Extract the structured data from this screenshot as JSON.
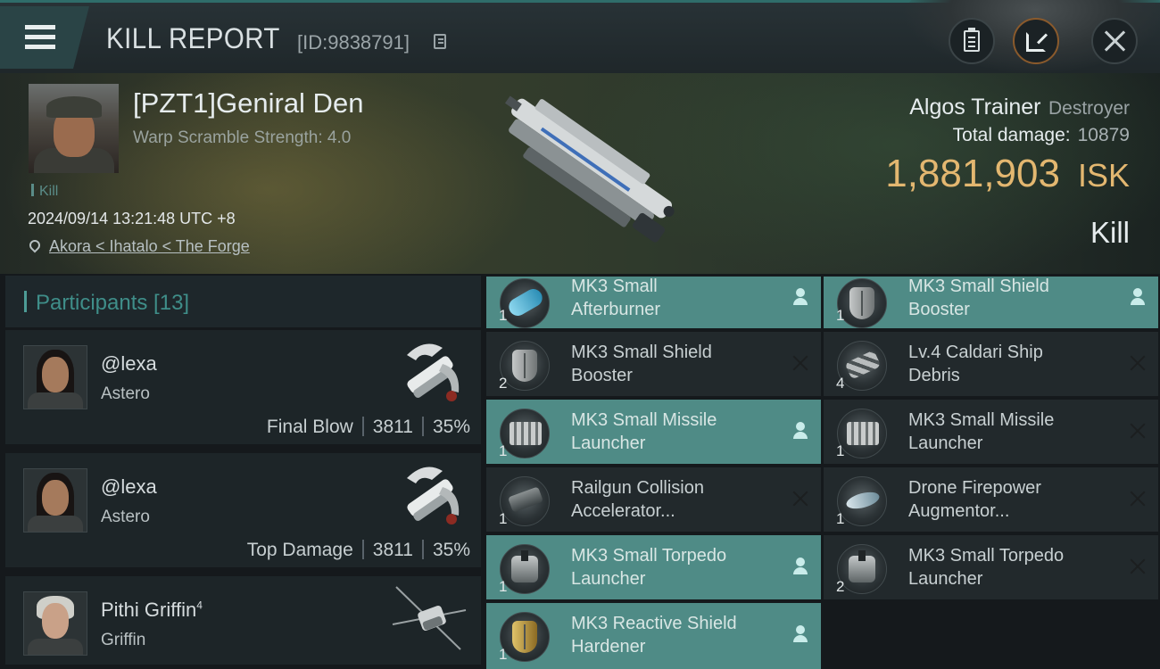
{
  "header": {
    "title": "KILL REPORT",
    "report_id": "[ID:9838791]"
  },
  "victim": {
    "pilot_name": "[PZT1]Geniral Den",
    "warp_scramble": "Warp Scramble Strength: 4.0",
    "kill_tag": "Kill",
    "timestamp": "2024/09/14 13:21:48 UTC +8",
    "location": "Akora < Ihatalo < The Forge",
    "ship_name": "Algos Trainer",
    "ship_class": "Destroyer",
    "total_damage_label": "Total damage:",
    "total_damage_value": "10879",
    "isk_value": "1,881,903",
    "isk_unit": "ISK",
    "kill_type": "Kill"
  },
  "participants": {
    "title": "Participants [13]",
    "items": [
      {
        "name": "@lexa",
        "rank_sup": "",
        "ship": "Astero",
        "role": "Final Blow",
        "damage": "3811",
        "percent": "35%"
      },
      {
        "name": "@lexa",
        "rank_sup": "",
        "ship": "Astero",
        "role": "Top Damage",
        "damage": "3811",
        "percent": "35%"
      },
      {
        "name": "Pithi Griffin",
        "rank_sup": "4",
        "ship": "Griffin",
        "role": "",
        "damage": "",
        "percent": ""
      }
    ]
  },
  "modules": [
    {
      "label": "MK3 Small\nAfterburner",
      "qty": "1",
      "state": "fitted",
      "icon": "afterburner-icon"
    },
    {
      "label": "MK3 Small Shield\nBooster",
      "qty": "1",
      "state": "fitted",
      "icon": "shield-booster-icon"
    },
    {
      "label": "MK3 Small Shield\nBooster",
      "qty": "2",
      "state": "destroyed",
      "icon": "shield-booster-icon"
    },
    {
      "label": "Lv.4 Caldari Ship\nDebris",
      "qty": "4",
      "state": "destroyed",
      "icon": "ship-debris-icon"
    },
    {
      "label": "MK3 Small Missile\nLauncher",
      "qty": "1",
      "state": "fitted",
      "icon": "missile-launcher-icon"
    },
    {
      "label": "MK3 Small Missile\nLauncher",
      "qty": "1",
      "state": "destroyed",
      "icon": "missile-launcher-icon"
    },
    {
      "label": "Railgun Collision\nAccelerator...",
      "qty": "1",
      "state": "destroyed",
      "icon": "railgun-icon"
    },
    {
      "label": "Drone Firepower\nAugmentor...",
      "qty": "1",
      "state": "destroyed",
      "icon": "drone-augmentor-icon"
    },
    {
      "label": "MK3 Small Torpedo\nLauncher",
      "qty": "1",
      "state": "fitted",
      "icon": "torpedo-launcher-icon"
    },
    {
      "label": "MK3 Small Torpedo\nLauncher",
      "qty": "2",
      "state": "destroyed",
      "icon": "torpedo-launcher-icon"
    },
    {
      "label": "MK3 Reactive Shield\nHardener",
      "qty": "1",
      "state": "fitted",
      "icon": "shield-hardener-icon"
    }
  ],
  "colors": {
    "accent": "#4f8b86",
    "isk": "#e3b770",
    "background": "#15191c"
  }
}
